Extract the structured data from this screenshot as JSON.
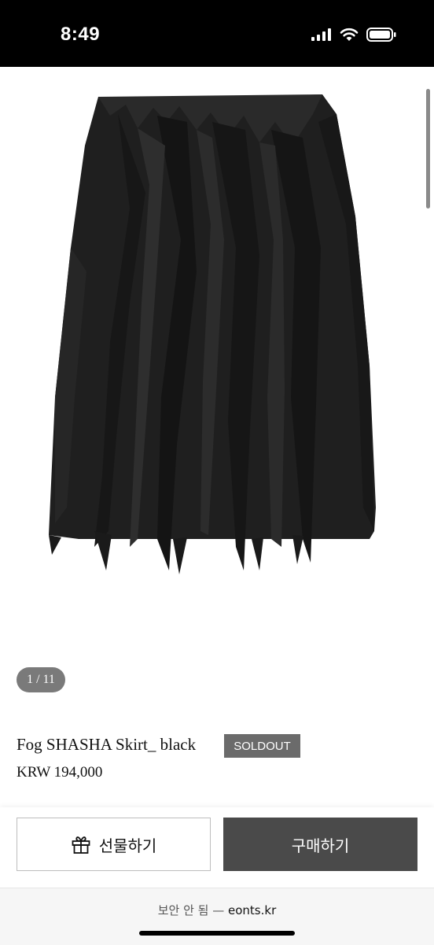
{
  "status_bar": {
    "time": "8:49",
    "icons": [
      "signal-icon",
      "wifi-icon",
      "battery-icon"
    ]
  },
  "product": {
    "image_counter": "1 / 11",
    "title": "Fog SHASHA Skirt_ black",
    "status_badge": "SOLDOUT",
    "price": "KRW 194,000"
  },
  "actions": {
    "gift_label": "선물하기",
    "buy_label": "구매하기",
    "gift_icon": "gift-icon"
  },
  "browser": {
    "security_text": "보안 안 됨 — ",
    "domain": "eonts.kr"
  },
  "colors": {
    "status_bar": "#000000",
    "buy_button": "#4a4a4a",
    "badge": "#6b6b6b",
    "counter": "#7a7a7a"
  }
}
